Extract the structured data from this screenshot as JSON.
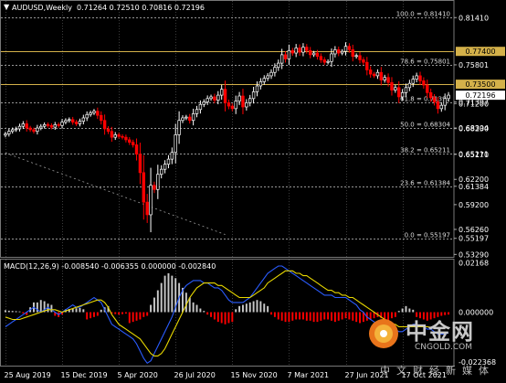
{
  "header": {
    "symbol_label": "AUDUSD,Weekly",
    "ohlc": "0.71264 0.72510 0.70816 0.72196"
  },
  "colors": {
    "bull": "#ffffff",
    "bear": "#ff0000",
    "grid": "#3c3c3c",
    "fib_line": "#c8c8c8",
    "hline": "#d4b14a",
    "macd_line": "#2a5cff",
    "signal_line": "#e8d800",
    "hist_pos": "#c8c8c8",
    "hist_neg": "#ff0000",
    "price_bg": "#ffffff"
  },
  "chart_data": [
    {
      "type": "candlestick",
      "title": "AUDUSD,Weekly",
      "ylim": [
        0.53,
        0.835
      ],
      "y_axis_ticks": [
        "0.81410",
        "0.77400",
        "0.75801",
        "0.73500",
        "0.71200",
        "0.71397",
        "0.72196",
        "0.68230",
        "0.68304",
        "0.65170",
        "0.65211",
        "0.62200",
        "0.61384",
        "0.59200",
        "0.56260",
        "0.55197",
        "0.53290"
      ],
      "x_tick_labels": [
        "25 Aug 2019",
        "15 Dec 2019",
        "5 Apr 2020",
        "26 Jul 2020",
        "15 Nov 2020",
        "7 Mar 2021",
        "27 Jun 2021",
        "17 Oct 2021"
      ],
      "current_price": 0.72196,
      "horizontal_levels": [
        {
          "price": 0.774,
          "label": "0.77400"
        },
        {
          "price": 0.735,
          "label": "0.73500"
        }
      ],
      "fibonacci": [
        {
          "label": "100.0 = 0.81410",
          "price": 0.8141
        },
        {
          "label": "78.6 = 0.75801",
          "price": 0.75801
        },
        {
          "label": "61.8 = 0.71397",
          "price": 0.71397
        },
        {
          "label": "50.0 = 0.68304",
          "price": 0.68304
        },
        {
          "label": "38.2 = 0.65211",
          "price": 0.65211
        },
        {
          "label": "23.6 = 0.61384",
          "price": 0.61384
        },
        {
          "label": "0.0 = 0.55197",
          "price": 0.55197
        }
      ],
      "trendline": {
        "from": [
          0,
          0.6535
        ],
        "to": [
          62,
          0.5565
        ]
      },
      "weekly_closes": [
        0.676,
        0.679,
        0.681,
        0.682,
        0.685,
        0.688,
        0.683,
        0.681,
        0.679,
        0.683,
        0.685,
        0.687,
        0.686,
        0.684,
        0.687,
        0.686,
        0.69,
        0.692,
        0.693,
        0.69,
        0.688,
        0.691,
        0.695,
        0.699,
        0.701,
        0.703,
        0.698,
        0.692,
        0.682,
        0.679,
        0.672,
        0.675,
        0.673,
        0.672,
        0.669,
        0.666,
        0.663,
        0.652,
        0.63,
        0.595,
        0.58,
        0.615,
        0.61,
        0.628,
        0.634,
        0.64,
        0.646,
        0.654,
        0.675,
        0.692,
        0.695,
        0.696,
        0.692,
        0.7,
        0.705,
        0.711,
        0.714,
        0.718,
        0.72,
        0.716,
        0.722,
        0.729,
        0.713,
        0.709,
        0.706,
        0.715,
        0.721,
        0.708,
        0.713,
        0.718,
        0.726,
        0.733,
        0.738,
        0.742,
        0.745,
        0.749,
        0.755,
        0.76,
        0.77,
        0.765,
        0.775,
        0.772,
        0.778,
        0.773,
        0.779,
        0.775,
        0.77,
        0.772,
        0.768,
        0.764,
        0.761,
        0.762,
        0.771,
        0.776,
        0.772,
        0.774,
        0.78,
        0.776,
        0.768,
        0.769,
        0.764,
        0.761,
        0.752,
        0.747,
        0.745,
        0.749,
        0.74,
        0.743,
        0.737,
        0.728,
        0.731,
        0.72,
        0.725,
        0.731,
        0.736,
        0.741,
        0.745,
        0.739,
        0.734,
        0.725,
        0.719,
        0.714,
        0.706,
        0.71,
        0.718,
        0.722
      ]
    },
    {
      "type": "macd",
      "title": "MACD(12,26,9) -0.008540 -0.006355 0.000000 -0.002840",
      "params": "12,26,9",
      "values": {
        "macd": -0.00854,
        "signal": -0.006355,
        "hist": 0.0,
        "osma": -0.00284
      },
      "ylim": [
        -0.022,
        0.022
      ],
      "y_axis_ticks": [
        "0.02168",
        "0.000000",
        "-0.022368"
      ],
      "series": [
        {
          "name": "MACD",
          "values": [
            -0.006,
            -0.005,
            -0.004,
            -0.003,
            -0.002,
            -0.001,
            0.0,
            0.001,
            0.002,
            0.001,
            0.0,
            0.001,
            0.002,
            0.001,
            0.0,
            -0.001,
            0.0,
            0.001,
            0.002,
            0.003,
            0.002,
            0.002,
            0.003,
            0.004,
            0.005,
            0.006,
            0.005,
            0.004,
            0.001,
            -0.002,
            -0.005,
            -0.006,
            -0.007,
            -0.008,
            -0.009,
            -0.01,
            -0.011,
            -0.013,
            -0.016,
            -0.019,
            -0.021,
            -0.02,
            -0.017,
            -0.014,
            -0.011,
            -0.008,
            -0.005,
            -0.002,
            0.002,
            0.006,
            0.009,
            0.011,
            0.012,
            0.013,
            0.013,
            0.013,
            0.012,
            0.012,
            0.011,
            0.01,
            0.01,
            0.009,
            0.007,
            0.005,
            0.004,
            0.004,
            0.004,
            0.004,
            0.005,
            0.006,
            0.008,
            0.01,
            0.012,
            0.014,
            0.016,
            0.017,
            0.018,
            0.019,
            0.019,
            0.018,
            0.017,
            0.016,
            0.015,
            0.014,
            0.013,
            0.012,
            0.011,
            0.01,
            0.009,
            0.008,
            0.007,
            0.007,
            0.007,
            0.006,
            0.006,
            0.006,
            0.006,
            0.005,
            0.004,
            0.003,
            0.001,
            0.0,
            -0.002,
            -0.003,
            -0.004,
            -0.005,
            -0.006,
            -0.006,
            -0.007,
            -0.007,
            -0.007,
            -0.008,
            -0.008,
            -0.007,
            -0.006,
            -0.005,
            -0.005,
            -0.006,
            -0.006,
            -0.007,
            -0.007,
            -0.008,
            -0.009,
            -0.009,
            -0.009,
            -0.0085
          ]
        },
        {
          "name": "Signal",
          "values": [
            -0.002,
            -0.0025,
            -0.003,
            -0.003,
            -0.003,
            -0.0025,
            -0.002,
            -0.0015,
            -0.001,
            -0.0005,
            0.0,
            0.0005,
            0.001,
            0.001,
            0.001,
            0.0005,
            0.0,
            0.0005,
            0.001,
            0.0015,
            0.002,
            0.0025,
            0.003,
            0.0035,
            0.004,
            0.0045,
            0.005,
            0.005,
            0.004,
            0.002,
            -0.001,
            -0.003,
            -0.005,
            -0.006,
            -0.007,
            -0.008,
            -0.009,
            -0.01,
            -0.011,
            -0.013,
            -0.015,
            -0.017,
            -0.018,
            -0.018,
            -0.017,
            -0.015,
            -0.012,
            -0.009,
            -0.006,
            -0.003,
            0.0,
            0.003,
            0.006,
            0.008,
            0.01,
            0.011,
            0.012,
            0.012,
            0.012,
            0.012,
            0.011,
            0.011,
            0.01,
            0.009,
            0.008,
            0.007,
            0.006,
            0.006,
            0.006,
            0.006,
            0.007,
            0.008,
            0.009,
            0.01,
            0.012,
            0.013,
            0.014,
            0.015,
            0.016,
            0.017,
            0.017,
            0.017,
            0.016,
            0.016,
            0.015,
            0.015,
            0.014,
            0.013,
            0.012,
            0.011,
            0.01,
            0.009,
            0.009,
            0.008,
            0.008,
            0.007,
            0.007,
            0.006,
            0.006,
            0.005,
            0.004,
            0.003,
            0.002,
            0.001,
            0.0,
            -0.001,
            -0.002,
            -0.003,
            -0.004,
            -0.005,
            -0.005,
            -0.006,
            -0.006,
            -0.006,
            -0.006,
            -0.006,
            -0.006,
            -0.006,
            -0.006,
            -0.006,
            -0.0062,
            -0.0063,
            -0.0064,
            -0.0064,
            -0.0064,
            -0.0064
          ]
        }
      ],
      "histogram": [
        0.0008,
        0.0006,
        0.0005,
        0.0004,
        0.0003,
        -0.0005,
        -0.0012,
        0.002,
        0.004,
        0.004,
        0.005,
        0.0045,
        0.0035,
        0.003,
        -0.0015,
        -0.002,
        -0.001,
        0.0012,
        0.0013,
        0.0015,
        0.0016,
        0.0017,
        0.0012,
        -0.003,
        -0.0025,
        -0.002,
        -0.0015,
        0.001,
        0.002,
        0.0025,
        -0.0006,
        -0.0008,
        -0.001,
        -0.0008,
        -0.0006,
        -0.0045,
        -0.004,
        -0.0035,
        -0.003,
        -0.002,
        -0.0015,
        0.003,
        0.006,
        0.009,
        0.012,
        0.015,
        0.016,
        0.015,
        0.014,
        0.012,
        0.01,
        0.008,
        0.006,
        0.004,
        0.003,
        0.0015,
        0.0005,
        -0.001,
        -0.002,
        -0.003,
        -0.004,
        -0.0045,
        -0.005,
        -0.0045,
        -0.004,
        0.0012,
        0.0025,
        0.003,
        0.0035,
        0.004,
        0.0045,
        0.005,
        0.0045,
        0.0035,
        0.0025,
        -0.001,
        -0.002,
        -0.003,
        -0.0035,
        -0.004,
        -0.004,
        -0.0035,
        -0.003,
        -0.003,
        -0.003,
        -0.0035,
        -0.0035,
        -0.004,
        -0.004,
        -0.0035,
        -0.003,
        -0.003,
        -0.0035,
        -0.004,
        -0.0035,
        -0.003,
        -0.0025,
        -0.003,
        -0.0035,
        -0.004,
        -0.0045,
        -0.004,
        -0.0035,
        -0.003,
        -0.0025,
        -0.002,
        -0.0025,
        -0.003,
        -0.0035,
        -0.0025,
        -0.002,
        0.0005,
        0.0015,
        0.0025,
        0.0015,
        0.001,
        -0.002,
        -0.0025,
        -0.003,
        -0.0035,
        -0.003,
        -0.0025,
        -0.002,
        -0.0015,
        -0.0012,
        -0.001
      ]
    }
  ],
  "watermark": {
    "title": "中金网",
    "url": "CNGOLD.COM",
    "subtitle": "中文财经新媒体"
  }
}
